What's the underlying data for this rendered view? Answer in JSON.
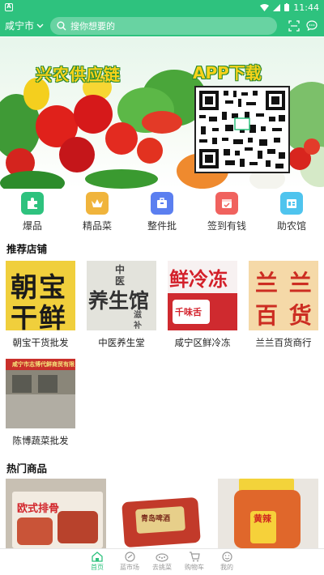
{
  "status_bar": {
    "time": "11:44",
    "app_badge": "A"
  },
  "header": {
    "city": "咸宁市",
    "search_placeholder": "搜你想要的"
  },
  "banner": {
    "title": "兴农供应链",
    "app_text": "APP下载"
  },
  "quick_nav": [
    {
      "label": "爆品",
      "icon": "puzzle-icon",
      "color": "#2ec27e"
    },
    {
      "label": "精品菜",
      "icon": "crown-icon",
      "color": "#f0b43c"
    },
    {
      "label": "整件批",
      "icon": "box-icon",
      "color": "#5b7ff0"
    },
    {
      "label": "签到有钱",
      "icon": "calendar-icon",
      "color": "#f0625e"
    },
    {
      "label": "助农馆",
      "icon": "store-icon",
      "color": "#4fc4ee"
    }
  ],
  "sections": {
    "recommended_title": "推荐店铺",
    "hot_title": "热门商品"
  },
  "shops": [
    {
      "name": "朝宝干货批发",
      "sign": [
        "朝宝",
        "干鲜"
      ]
    },
    {
      "name": "中医养生堂",
      "sign": [
        "中",
        "医",
        "养生馆",
        "滋",
        "补"
      ]
    },
    {
      "name": "咸宁区鲜冷冻",
      "sign": [
        "鲜冷冻",
        "千味舌"
      ]
    },
    {
      "name": "兰兰百货商行",
      "sign": [
        "兰 兰",
        "百 货"
      ]
    },
    {
      "name": "陈博蔬菜批发",
      "sign": [
        "咸宁市志博代鲜商贸有限"
      ]
    }
  ],
  "products": [
    {
      "label": "欧式排骨"
    },
    {
      "label": "青岛啤酒"
    },
    {
      "label": "黄辣"
    }
  ],
  "bottom_nav": [
    {
      "label": "首页",
      "icon": "home-icon",
      "active": true
    },
    {
      "label": "蓝市场",
      "icon": "market-icon",
      "active": false
    },
    {
      "label": "去挑菜",
      "icon": "vegetable-icon",
      "active": false
    },
    {
      "label": "购物车",
      "icon": "cart-icon",
      "active": false
    },
    {
      "label": "我的",
      "icon": "profile-icon",
      "active": false
    }
  ],
  "colors": {
    "brand_green": "#2ec27e"
  }
}
